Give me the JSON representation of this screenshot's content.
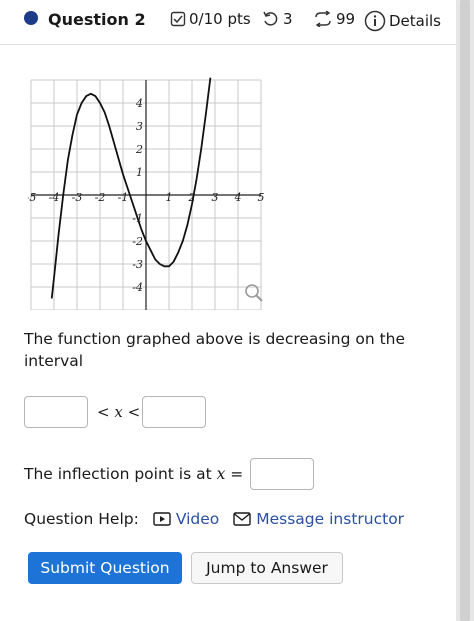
{
  "header": {
    "question_title": "Question 2",
    "points": "0/10 pts",
    "tries": "3",
    "submissions": "99",
    "details_label": "Details"
  },
  "graph": {
    "x_ticks": [
      "-5",
      "-4",
      "-3",
      "-2",
      "-1",
      "1",
      "2",
      "3",
      "4",
      "5"
    ],
    "y_ticks": [
      "4",
      "3",
      "2",
      "1",
      "-1",
      "-2",
      "-3",
      "-4"
    ],
    "function_points": [
      [
        -4.1,
        -4.5
      ],
      [
        -4.0,
        -3.6
      ],
      [
        -3.8,
        -1.7
      ],
      [
        -3.6,
        0.0
      ],
      [
        -3.4,
        1.5
      ],
      [
        -3.2,
        2.6
      ],
      [
        -3.0,
        3.5
      ],
      [
        -2.8,
        4.0
      ],
      [
        -2.6,
        4.3
      ],
      [
        -2.4,
        4.4
      ],
      [
        -2.2,
        4.3
      ],
      [
        -2.0,
        4.0
      ],
      [
        -1.8,
        3.6
      ],
      [
        -1.6,
        3.0
      ],
      [
        -1.4,
        2.3
      ],
      [
        -1.2,
        1.6
      ],
      [
        -1.0,
        0.9
      ],
      [
        -0.8,
        0.3
      ],
      [
        -0.6,
        -0.3
      ],
      [
        -0.4,
        -0.9
      ],
      [
        -0.2,
        -1.5
      ],
      [
        0.0,
        -2.0
      ],
      [
        0.2,
        -2.4
      ],
      [
        0.4,
        -2.8
      ],
      [
        0.6,
        -3.0
      ],
      [
        0.8,
        -3.1
      ],
      [
        1.0,
        -3.1
      ],
      [
        1.2,
        -2.9
      ],
      [
        1.4,
        -2.5
      ],
      [
        1.6,
        -2.0
      ],
      [
        1.8,
        -1.3
      ],
      [
        2.0,
        -0.4
      ],
      [
        2.2,
        0.7
      ],
      [
        2.4,
        2.0
      ],
      [
        2.6,
        3.5
      ],
      [
        2.8,
        5.1
      ]
    ],
    "zoom_icon": "magnifier-icon"
  },
  "question": {
    "prompt": "The function graphed above is decreasing on the interval",
    "inequality_lt_1": "<",
    "inequality_var": "x",
    "inequality_lt_2": "<",
    "box1_value": "",
    "box2_value": "",
    "inflection_text": "The inflection point is at",
    "inflection_var": "x",
    "inflection_eq": "=",
    "inflection_value": ""
  },
  "help": {
    "label": "Question Help:",
    "video_label": "Video",
    "message_label": "Message instructor"
  },
  "buttons": {
    "submit": "Submit Question",
    "jump": "Jump to Answer"
  },
  "colors": {
    "accent": "#1e73d6",
    "link": "#2a4fa3",
    "dot": "#1e3b8a"
  }
}
